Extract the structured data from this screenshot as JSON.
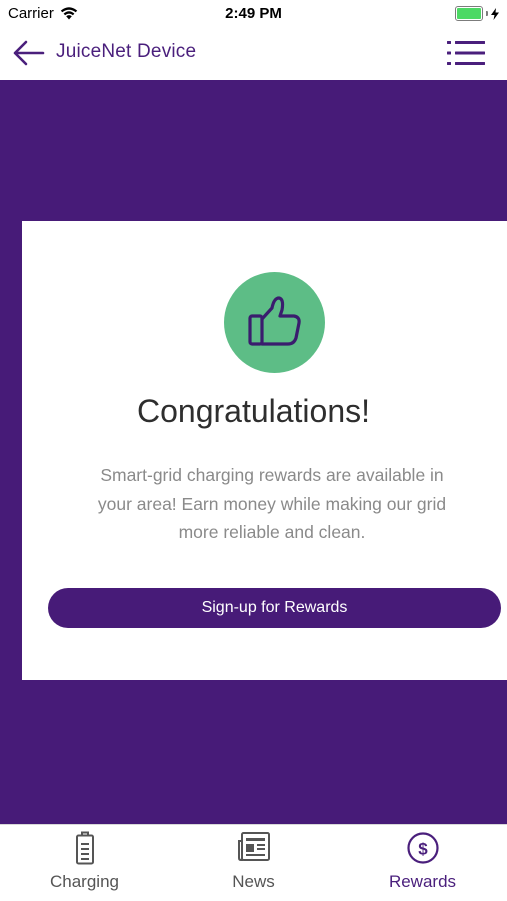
{
  "status_bar": {
    "carrier": "Carrier",
    "time": "2:49 PM",
    "battery_level": 1.0,
    "battery_color": "#4cd964"
  },
  "nav": {
    "title": "JuiceNet Device",
    "back_icon": "arrow-left-icon",
    "menu_icon": "list-menu-icon",
    "accent_color": "#4a1f7c"
  },
  "card": {
    "icon": "thumbs-up-icon",
    "icon_bg_color": "#5dbd86",
    "title": "Congratulations!",
    "body_lines": [
      "Smart-grid charging rewards are available in",
      "your area! Earn money while making our grid",
      "more reliable and clean."
    ],
    "signup_label": "Sign-up for Rewards"
  },
  "background_color": "#471b78",
  "tabs": [
    {
      "label": "Charging",
      "icon": "battery-icon",
      "active": false
    },
    {
      "label": "News",
      "icon": "newspaper-icon",
      "active": false
    },
    {
      "label": "Rewards",
      "icon": "dollar-circle-icon",
      "active": true
    }
  ]
}
